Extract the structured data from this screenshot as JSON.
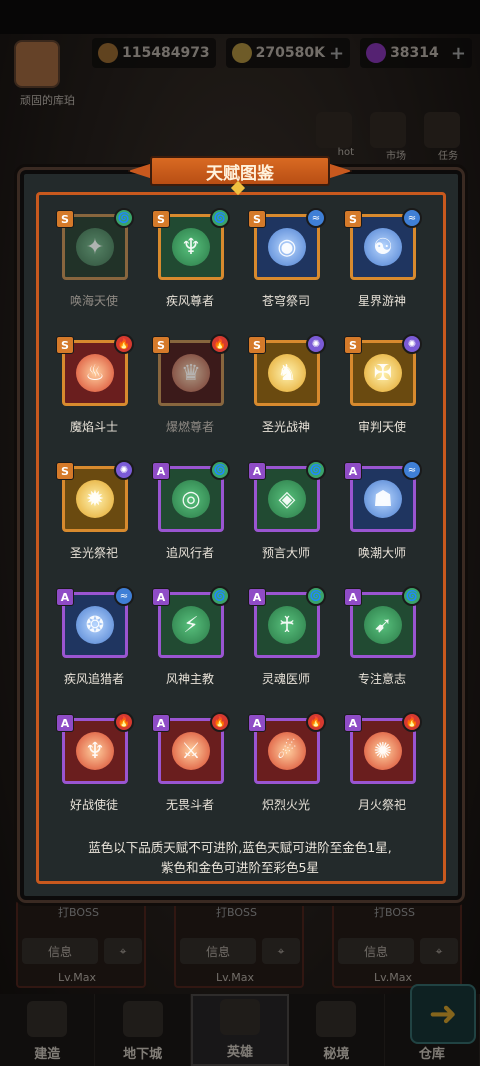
{
  "resources": {
    "anchor": "115484973",
    "coin": "270580K",
    "gem": "38314"
  },
  "player": {
    "name": "顽固的库珀"
  },
  "side_tabs": [
    "hot",
    "市场",
    "任务"
  ],
  "panel": {
    "title": "天赋图鉴",
    "talents": [
      {
        "name": "唤海天使",
        "grade": "S",
        "element": "wind",
        "color": "green",
        "glyph": "✦",
        "locked": true
      },
      {
        "name": "疾风尊者",
        "grade": "S",
        "element": "wind",
        "color": "green",
        "glyph": "♆",
        "locked": false
      },
      {
        "name": "苍穹祭司",
        "grade": "S",
        "element": "water",
        "color": "blue",
        "glyph": "◉",
        "locked": false
      },
      {
        "name": "星界游神",
        "grade": "S",
        "element": "water",
        "color": "blue",
        "glyph": "☯",
        "locked": false
      },
      {
        "name": "魔焰斗士",
        "grade": "S",
        "element": "fire",
        "color": "red",
        "glyph": "♨",
        "locked": false
      },
      {
        "name": "爆燃尊者",
        "grade": "S",
        "element": "fire",
        "color": "red",
        "glyph": "♛",
        "locked": true
      },
      {
        "name": "圣光战神",
        "grade": "S",
        "element": "light",
        "color": "gold",
        "glyph": "♞",
        "locked": false
      },
      {
        "name": "审判天使",
        "grade": "S",
        "element": "light",
        "color": "gold",
        "glyph": "✠",
        "locked": false
      },
      {
        "name": "圣光祭祀",
        "grade": "S",
        "element": "light",
        "color": "gold",
        "glyph": "✹",
        "locked": false
      },
      {
        "name": "追风行者",
        "grade": "A",
        "element": "wind",
        "color": "green",
        "glyph": "◎",
        "locked": false
      },
      {
        "name": "预言大师",
        "grade": "A",
        "element": "wind",
        "color": "green",
        "glyph": "◈",
        "locked": false
      },
      {
        "name": "唤潮大师",
        "grade": "A",
        "element": "water",
        "color": "blue",
        "glyph": "☗",
        "locked": false
      },
      {
        "name": "疾风追猎者",
        "grade": "A",
        "element": "water",
        "color": "blue",
        "glyph": "❂",
        "locked": false
      },
      {
        "name": "风神主教",
        "grade": "A",
        "element": "wind",
        "color": "green",
        "glyph": "⚡",
        "locked": false
      },
      {
        "name": "灵魂医师",
        "grade": "A",
        "element": "wind",
        "color": "green",
        "glyph": "♰",
        "locked": false
      },
      {
        "name": "专注意志",
        "grade": "A",
        "element": "wind",
        "color": "green",
        "glyph": "➹",
        "locked": false
      },
      {
        "name": "好战使徒",
        "grade": "A",
        "element": "fire",
        "color": "red",
        "glyph": "♆",
        "locked": false
      },
      {
        "name": "无畏斗者",
        "grade": "A",
        "element": "fire",
        "color": "red",
        "glyph": "⚔",
        "locked": false
      },
      {
        "name": "炽烈火光",
        "grade": "A",
        "element": "fire",
        "color": "red",
        "glyph": "☄",
        "locked": false
      },
      {
        "name": "月火祭祀",
        "grade": "A",
        "element": "fire",
        "color": "red",
        "glyph": "✺",
        "locked": false
      }
    ],
    "note_line1": "蓝色以下品质天赋不可进阶,蓝色天赋可进阶至金色1星,",
    "note_line2": "紫色和金色可进阶至彩色5星"
  },
  "heroes": [
    {
      "boss": "打BOSS",
      "info": "信息",
      "lv": "Lv.Max"
    },
    {
      "boss": "打BOSS",
      "info": "信息",
      "lv": "Lv.Max"
    },
    {
      "boss": "打BOSS",
      "info": "信息",
      "lv": "Lv.Max"
    }
  ],
  "nav": [
    "建造",
    "地下城",
    "英雄",
    "秘境",
    "仓库"
  ],
  "nav_active": "英雄"
}
